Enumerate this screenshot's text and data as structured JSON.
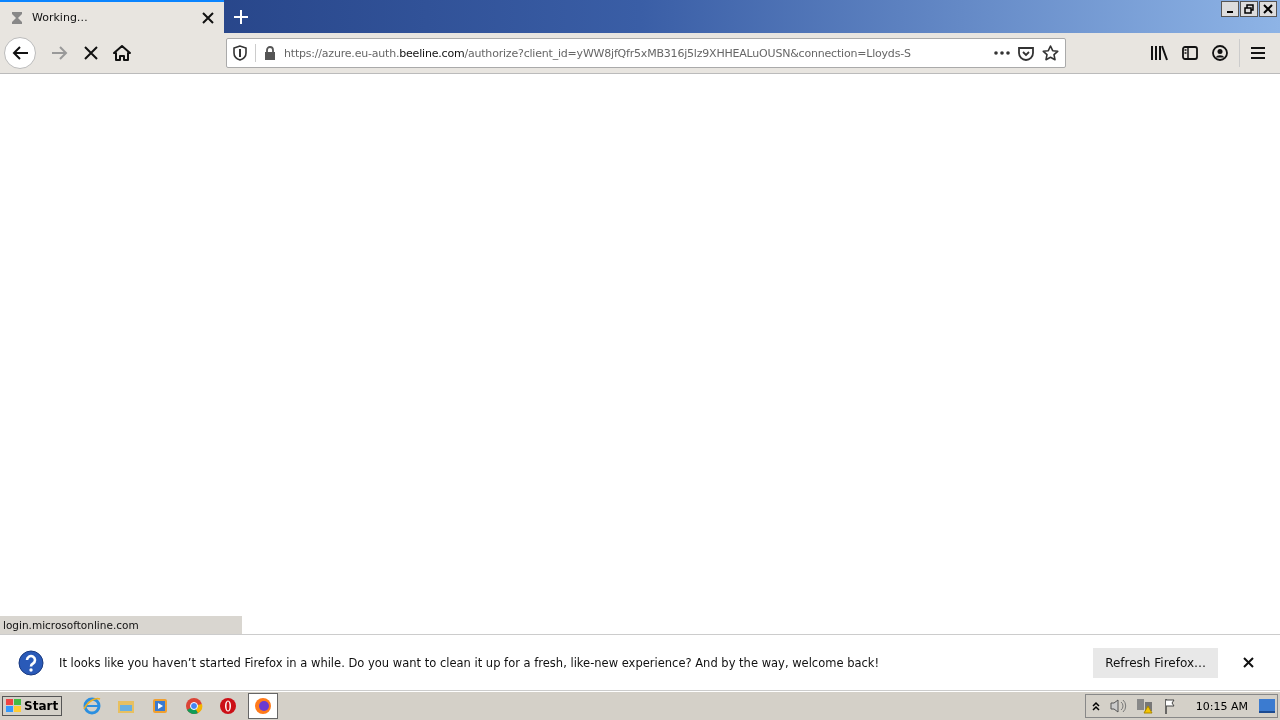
{
  "window": {
    "controls": [
      {
        "kind": "minimize"
      },
      {
        "kind": "restore"
      },
      {
        "kind": "close"
      }
    ]
  },
  "tabs": [
    {
      "title": "Working…",
      "selected": true,
      "loading": true
    }
  ],
  "toolbar": {
    "stop_visible": true
  },
  "url": {
    "prefix": "https://azure.eu-auth.",
    "domain": "beeline.com",
    "rest": "/authorize?client_id=yWW8jfQfr5xMB316j5lz9XHHEALuOUSN&connection=Lloyds-S"
  },
  "status_link": "login.microsoftonline.com",
  "notification": {
    "message": "It looks like you haven’t started Firefox in a while. Do you want to clean it up for a fresh, like-new experience? And by the way, welcome back!",
    "button": "Refresh Firefox…"
  },
  "taskbar": {
    "start": "Start",
    "apps": [
      {
        "kind": "ie",
        "selected": false
      },
      {
        "kind": "folder",
        "selected": false
      },
      {
        "kind": "media",
        "selected": false
      },
      {
        "kind": "chrome",
        "selected": false
      },
      {
        "kind": "opera",
        "selected": false
      },
      {
        "kind": "firefox",
        "selected": true
      }
    ],
    "clock": "10:15 AM"
  }
}
